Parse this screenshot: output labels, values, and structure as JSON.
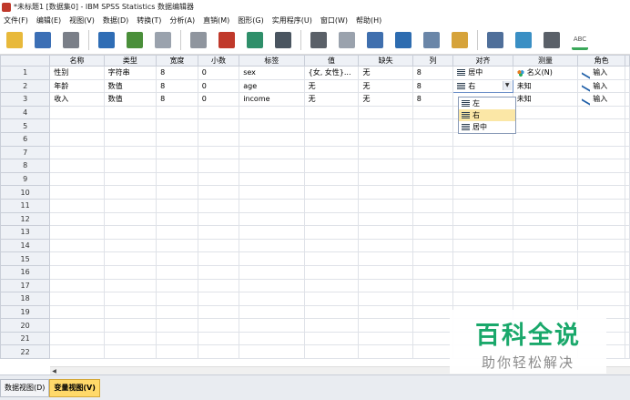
{
  "window": {
    "title": "*未标题1 [数据集0] - IBM SPSS Statistics 数据编辑器"
  },
  "menu": [
    "文件(F)",
    "编辑(E)",
    "视图(V)",
    "数据(D)",
    "转换(T)",
    "分析(A)",
    "直销(M)",
    "图形(G)",
    "实用程序(U)",
    "窗口(W)",
    "帮助(H)"
  ],
  "toolbar": {
    "icons": [
      {
        "name": "open-folder-icon",
        "color": "#e8b93b"
      },
      {
        "name": "save-icon",
        "color": "#3b6fb5"
      },
      {
        "name": "print-icon",
        "color": "#7a7f88"
      },
      {
        "name": "dialog-recall-icon",
        "color": "#2f6db5"
      },
      {
        "name": "undo-icon",
        "color": "#4a8f3a"
      },
      {
        "name": "redo-icon",
        "color": "#9aa2ad"
      },
      {
        "name": "goto-case-icon",
        "color": "#8f959e"
      },
      {
        "name": "goto-variable-icon",
        "color": "#c0392b"
      },
      {
        "name": "variables-icon",
        "color": "#2f8f6a"
      },
      {
        "name": "run-descriptives-icon",
        "color": "#4a5560"
      },
      {
        "name": "find-icon",
        "color": "#5a6068"
      },
      {
        "name": "insert-cases-icon",
        "color": "#9aa2ad"
      },
      {
        "name": "insert-variable-icon",
        "color": "#3f6fae"
      },
      {
        "name": "split-file-icon",
        "color": "#2d6cb0"
      },
      {
        "name": "weight-cases-icon",
        "color": "#6a86a8"
      },
      {
        "name": "select-cases-icon",
        "color": "#d6a33a"
      },
      {
        "name": "value-labels-icon",
        "color": "#4f6f9a"
      },
      {
        "name": "use-variable-sets-icon",
        "color": "#3a8fc4"
      },
      {
        "name": "show-all-variables-icon",
        "color": "#5a6068"
      },
      {
        "name": "spell-check-icon",
        "color": "#3aa85a"
      }
    ],
    "spell_label": "ABC"
  },
  "grid": {
    "columns": [
      "名称",
      "类型",
      "宽度",
      "小数",
      "标签",
      "值",
      "缺失",
      "列",
      "对齐",
      "测量",
      "角色"
    ],
    "rows": [
      {
        "num": "1",
        "name": "性别",
        "type": "字符串",
        "width": "8",
        "decimals": "0",
        "label": "sex",
        "values": "{女, 女性}...",
        "missing": "无",
        "columns": "8",
        "align": "居中",
        "measure": "名义(N)",
        "role": "输入"
      },
      {
        "num": "2",
        "name": "年龄",
        "type": "数值",
        "width": "8",
        "decimals": "0",
        "label": "age",
        "values": "无",
        "missing": "无",
        "columns": "8",
        "align": "右",
        "measure": "未知",
        "role": "输入"
      },
      {
        "num": "3",
        "name": "收入",
        "type": "数值",
        "width": "8",
        "decimals": "0",
        "label": "income",
        "values": "无",
        "missing": "无",
        "columns": "8",
        "align": "",
        "measure": "未知",
        "role": "输入"
      }
    ],
    "empty_row_numbers": [
      "4",
      "5",
      "6",
      "7",
      "8",
      "9",
      "10",
      "11",
      "12",
      "13",
      "14",
      "15",
      "16",
      "17",
      "18",
      "19",
      "20",
      "21",
      "22"
    ]
  },
  "align_dropdown": {
    "options": [
      "左",
      "右",
      "居中"
    ],
    "selected": "右"
  },
  "tabs": {
    "data_view": "数据视图(D)",
    "variable_view": "变量视图(V)"
  },
  "watermark": {
    "main": "百科全说",
    "sub": "助你轻松解决"
  }
}
